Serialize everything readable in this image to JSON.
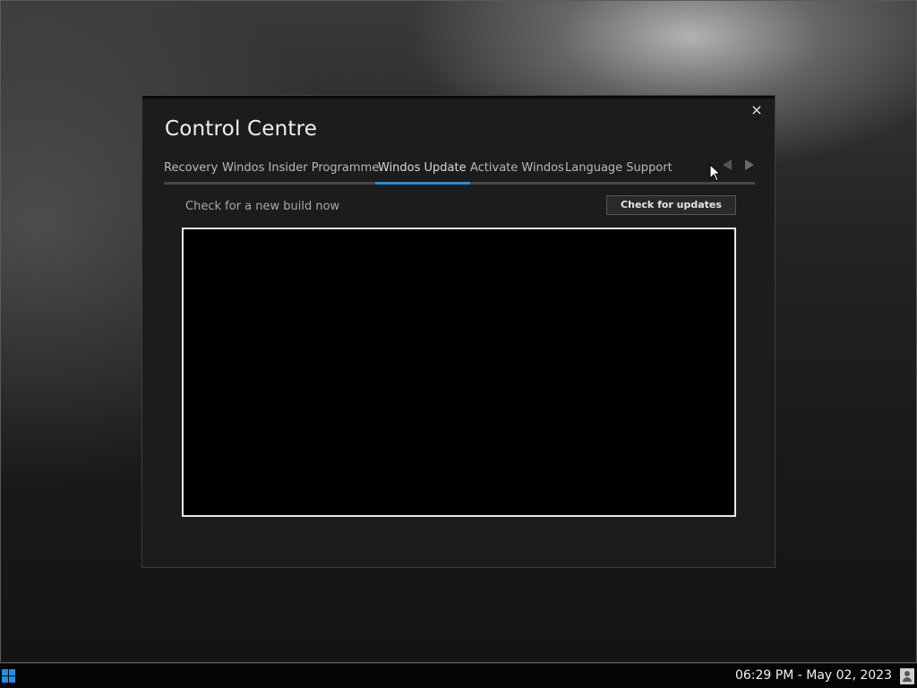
{
  "window": {
    "title": "Control Centre",
    "close_label": "×"
  },
  "tabs": [
    {
      "label": "Recovery",
      "active": false
    },
    {
      "label": "Windos Insider Programme",
      "active": false
    },
    {
      "label": "Windos Update",
      "active": true
    },
    {
      "label": "Activate Windos",
      "active": false
    },
    {
      "label": "Language Support",
      "active": false
    }
  ],
  "update_panel": {
    "subtitle": "Check for a new build now",
    "check_button_label": "Check for updates",
    "output": ""
  },
  "taskbar": {
    "clock": "06:29 PM - May 02, 2023"
  },
  "colors": {
    "accent": "#2a8fd1",
    "start_icon": "#1e90e8",
    "window_bg": "#1c1c1c"
  },
  "icons": [
    "close-icon",
    "arrow-left-icon",
    "arrow-right-icon",
    "start-icon",
    "user-icon",
    "mouse-cursor-icon"
  ]
}
